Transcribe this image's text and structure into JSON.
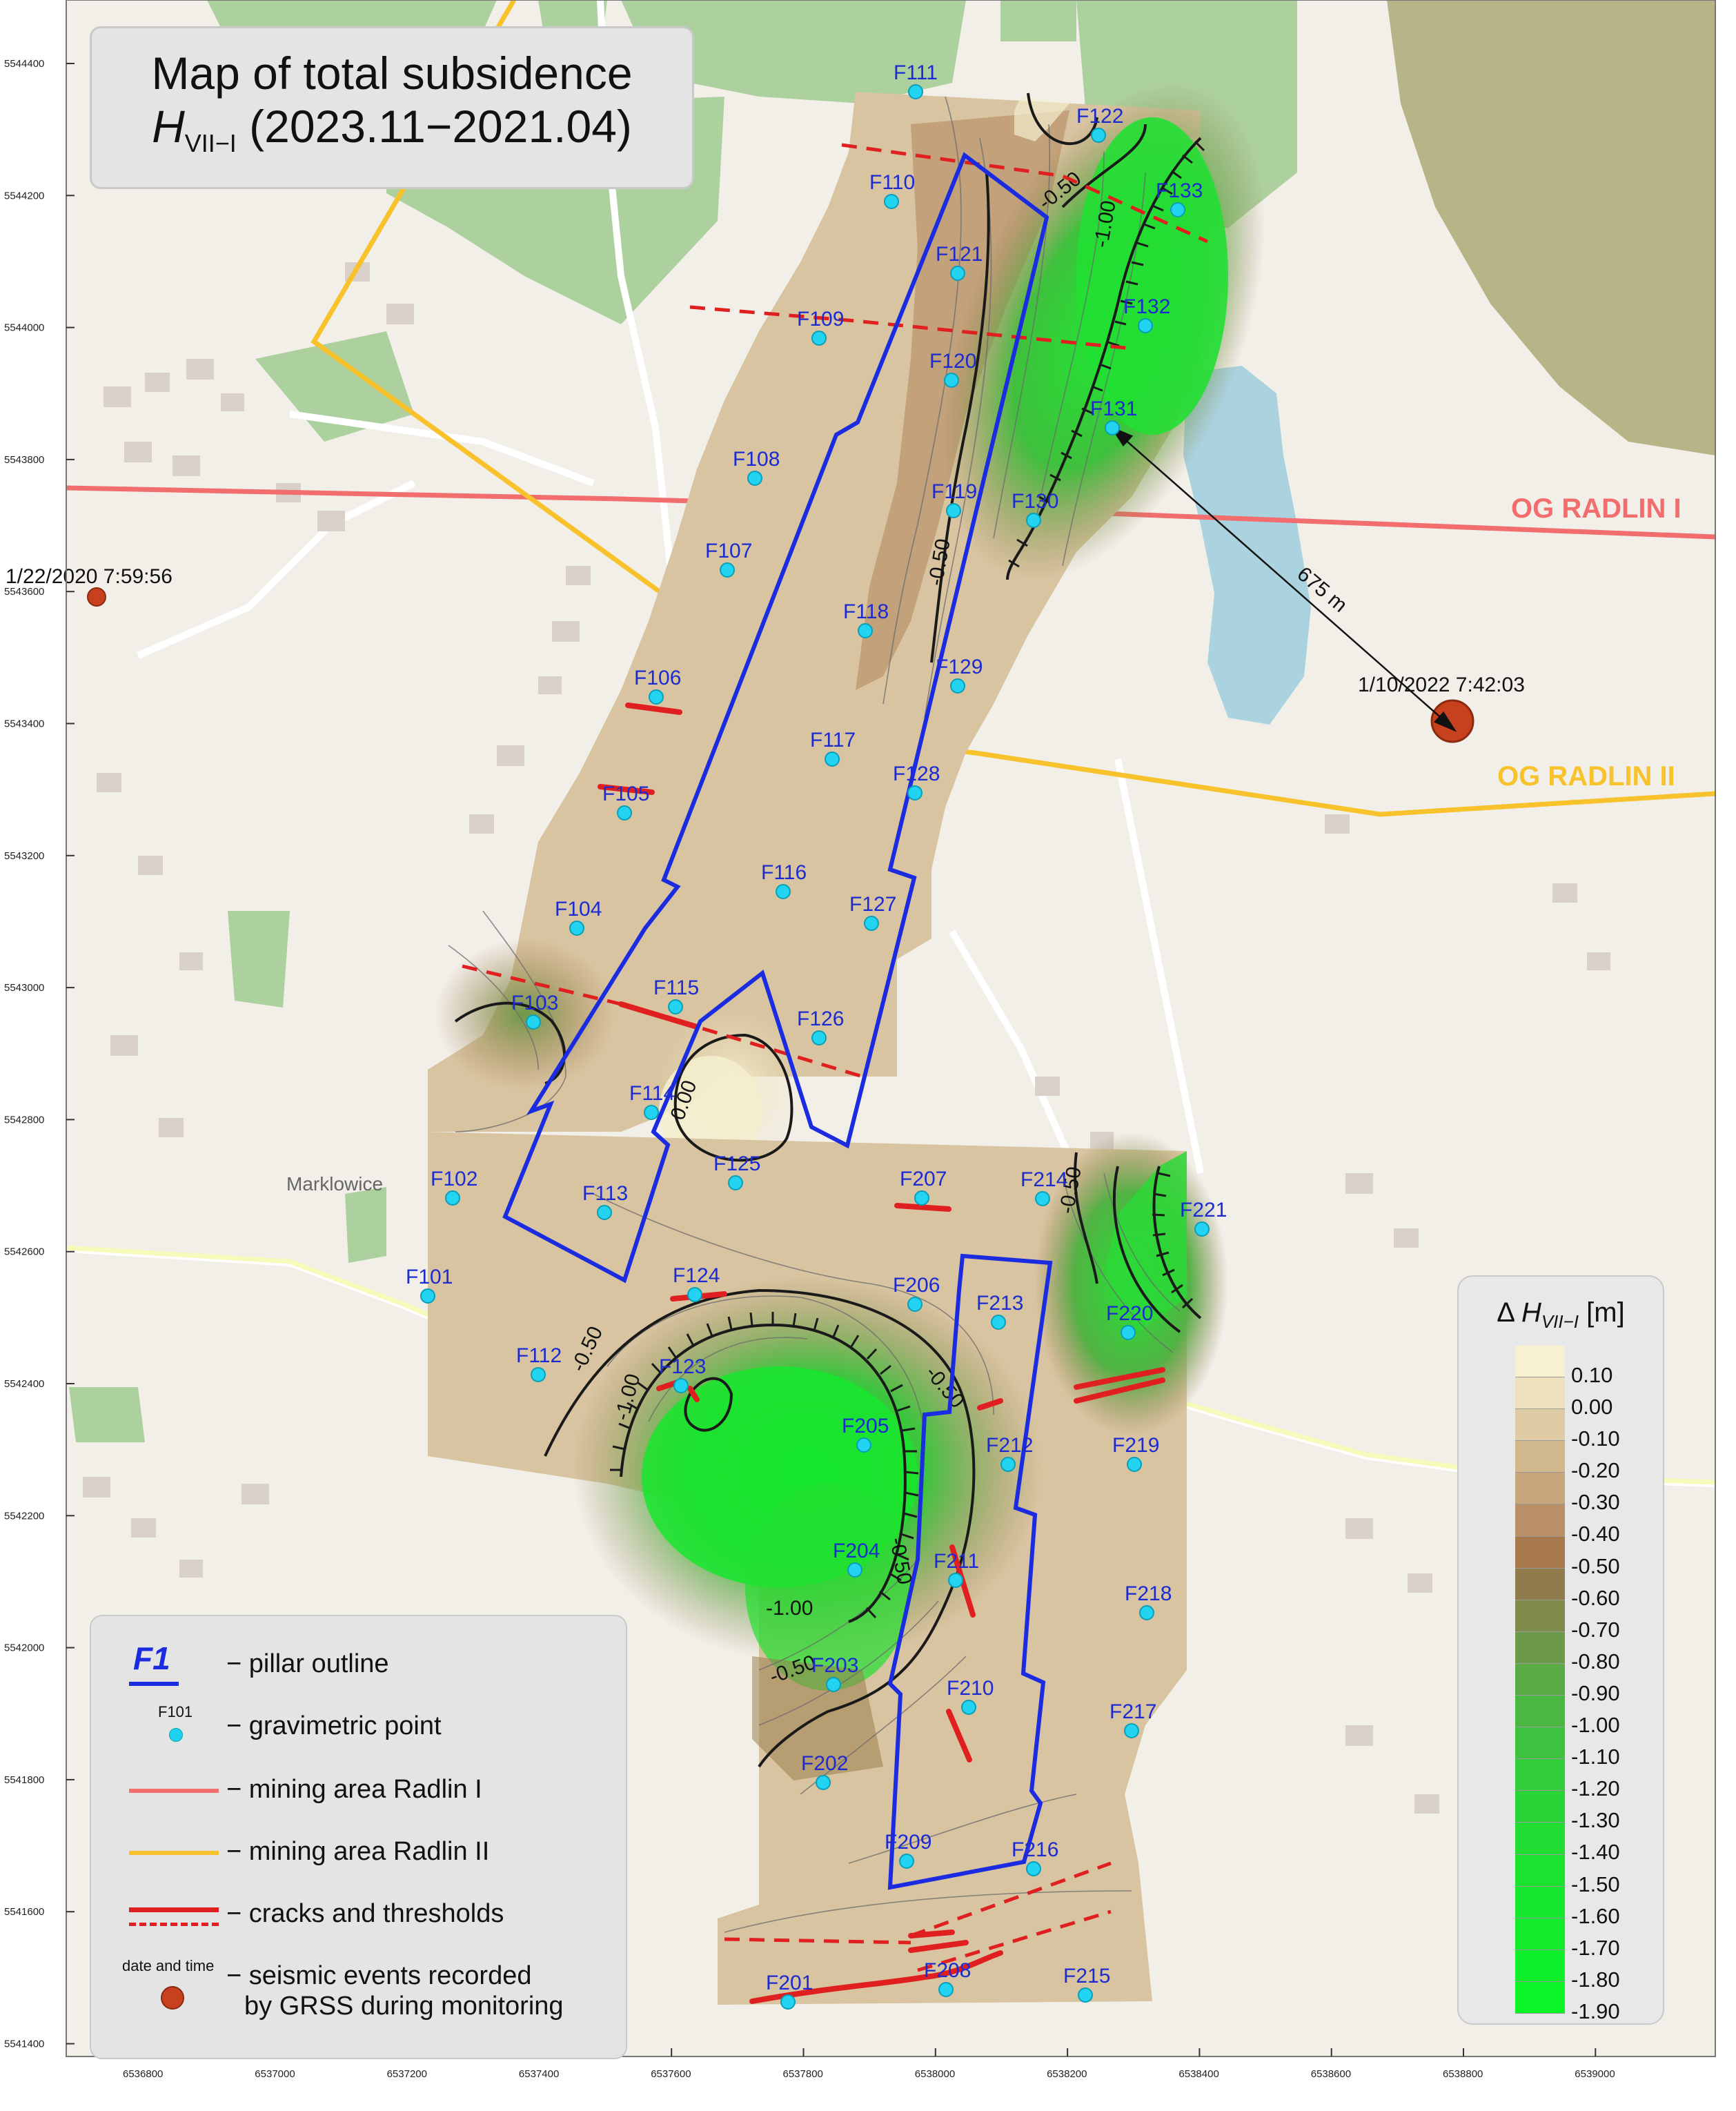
{
  "title": {
    "line1": "Map of total subsidence",
    "symbol": "H",
    "subscript": "VII−I",
    "period": "(2023.11−2021.04)"
  },
  "axes": {
    "y_ticks": [
      "5544400",
      "5544200",
      "5544000",
      "5543800",
      "5543600",
      "5543400",
      "5543200",
      "5543000",
      "5542800",
      "5542600",
      "5542400",
      "5542200",
      "5542000",
      "5541800",
      "5541600",
      "5541400"
    ],
    "x_ticks": [
      "6536800",
      "6537000",
      "6537200",
      "6537400",
      "6537600",
      "6537800",
      "6538000",
      "6538200",
      "6538400",
      "6538600",
      "6538800",
      "6539000"
    ]
  },
  "mining_areas": {
    "radlin_1": "OG RADLIN I",
    "radlin_2": "OG RADLIN II"
  },
  "map_labels": {
    "town": "Marklowice",
    "distance": "675 m"
  },
  "seismic_events": [
    {
      "label": "1/22/2020 7:59:56"
    },
    {
      "label": "1/10/2022 7:42:03"
    }
  ],
  "points": [
    "F111",
    "F122",
    "F110",
    "F133",
    "F121",
    "F109",
    "F132",
    "F120",
    "F131",
    "F108",
    "F119",
    "F130",
    "F107",
    "F118",
    "F129",
    "F106",
    "F117",
    "F128",
    "F105",
    "F116",
    "F127",
    "F104",
    "F115",
    "F126",
    "F103",
    "F114",
    "F125",
    "F102",
    "F113",
    "F207",
    "F214",
    "F221",
    "F101",
    "F124",
    "F206",
    "F213",
    "F220",
    "F112",
    "F123",
    "F205",
    "F212",
    "F219",
    "F204",
    "F211",
    "F218",
    "F203",
    "F210",
    "F217",
    "F202",
    "F209",
    "F216",
    "F201",
    "F208",
    "F215"
  ],
  "contour_labels": [
    "-0.50",
    "-1.00",
    "-0.50",
    "0.00",
    "-0.50",
    "-0.50",
    "-1.00",
    "-0.50",
    "-1.00",
    "-0.50",
    "-0.50"
  ],
  "legend": {
    "pillar_symbol": "F1",
    "pillar": "− pillar outline",
    "point_symbol": "F101",
    "point": "− gravimetric point",
    "radlin1": "− mining area Radlin I",
    "radlin2": "− mining area Radlin II",
    "cracks": "− cracks and thresholds",
    "seismic_symbol": "date and time",
    "seismic_line1": "− seismic events recorded",
    "seismic_line2": "by GRSS during monitoring"
  },
  "colorbar": {
    "title_prefix": "Δ",
    "title_symbol": "H",
    "title_sub": "VII−I",
    "title_unit": "[m]",
    "labels": [
      "0.10",
      "0.00",
      "-0.10",
      "-0.20",
      "-0.30",
      "-0.40",
      "-0.50",
      "-0.60",
      "-0.70",
      "-0.80",
      "-0.90",
      "-1.00",
      "-1.10",
      "-1.20",
      "-1.30",
      "-1.40",
      "-1.50",
      "-1.60",
      "-1.70",
      "-1.80",
      "-1.90"
    ],
    "colors": [
      "#f7f1cf",
      "#ece0bd",
      "#dfcca5",
      "#d2b88d",
      "#c8a57a",
      "#b98f65",
      "#a8794f",
      "#8f7b4a",
      "#7e8a4a",
      "#6d9a48",
      "#5aaa45",
      "#4bb743",
      "#3ec23f",
      "#33cc3a",
      "#2ad436",
      "#22dc33",
      "#1ce230",
      "#17e72e",
      "#12ec2c",
      "#0ef02a",
      "#0bf428"
    ]
  }
}
